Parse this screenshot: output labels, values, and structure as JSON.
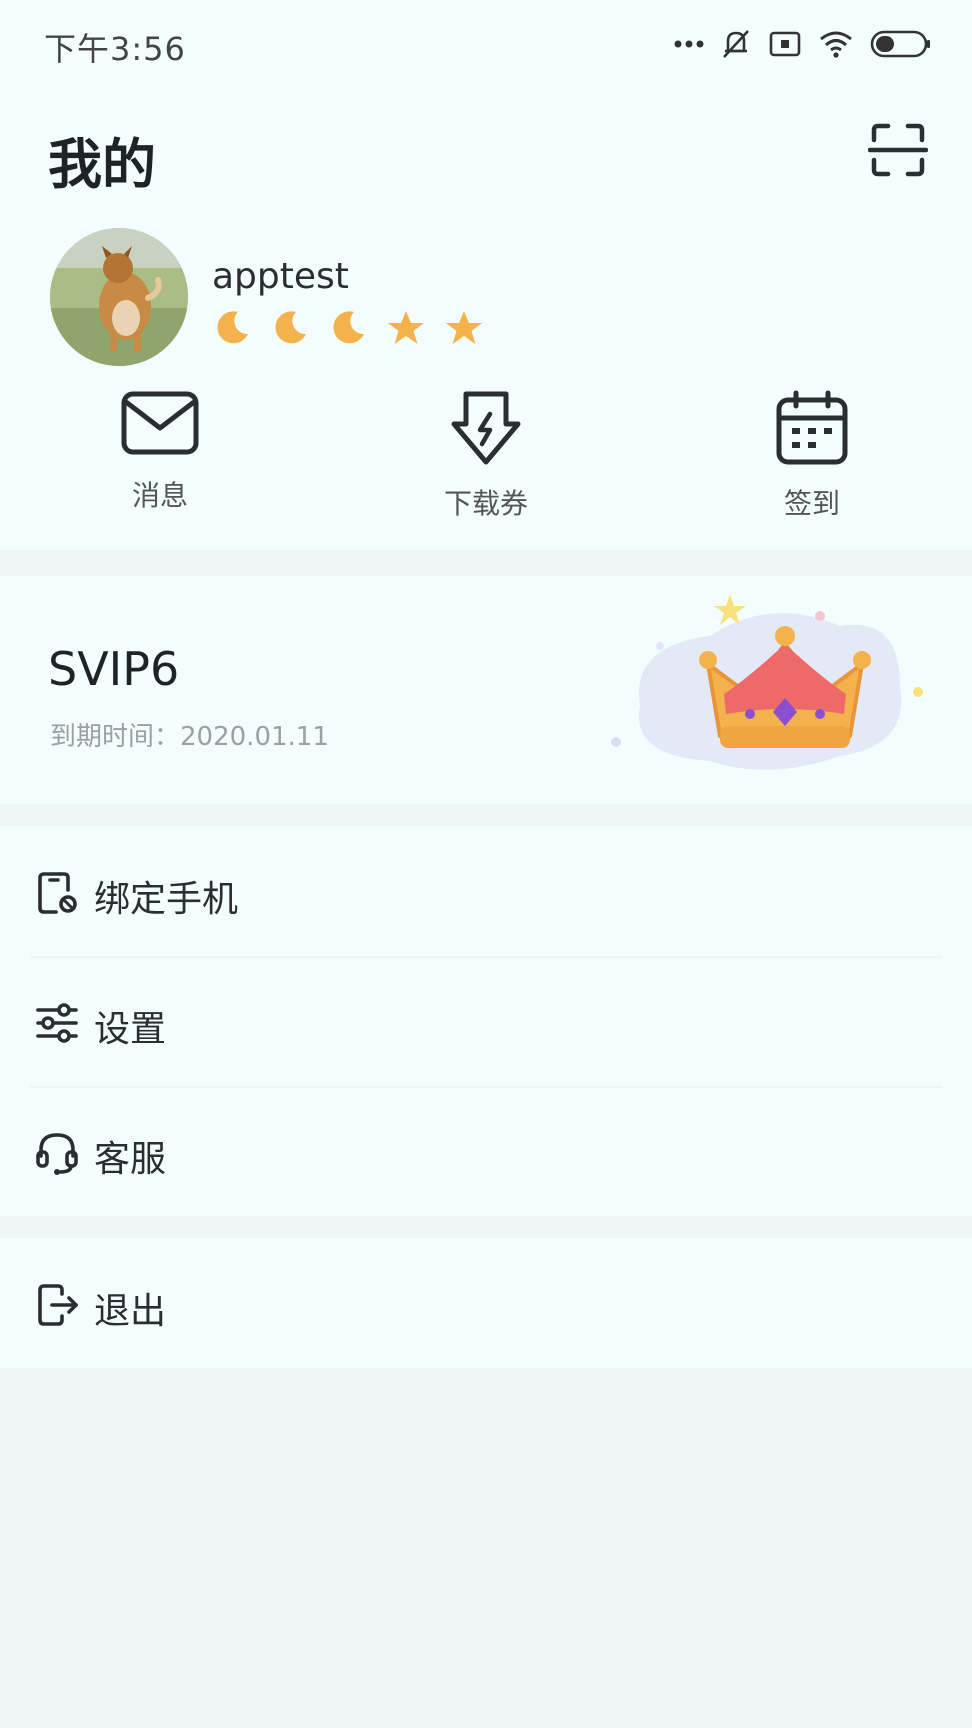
{
  "status_bar": {
    "time": "下午3:56",
    "icons": [
      "more-dots-icon",
      "bell-off-icon",
      "sim-icon",
      "wifi-icon",
      "battery-icon"
    ]
  },
  "header": {
    "title": "我的",
    "scan_icon": "scan-icon"
  },
  "profile": {
    "username": "apptest",
    "rank_icons": [
      "moon-icon",
      "moon-icon",
      "moon-icon",
      "star-icon",
      "star-icon"
    ]
  },
  "quick_actions": [
    {
      "label": "消息",
      "icon": "mail-icon"
    },
    {
      "label": "下载券",
      "icon": "download-ticket-icon"
    },
    {
      "label": "签到",
      "icon": "calendar-icon"
    }
  ],
  "vip": {
    "level": "SVIP6",
    "expire_label": "到期时间：",
    "expire_date": "2020.01.11",
    "badge_icon": "crown-icon"
  },
  "menu": [
    {
      "label": "绑定手机",
      "icon": "phone-bind-icon"
    },
    {
      "label": "设置",
      "icon": "settings-sliders-icon"
    },
    {
      "label": "客服",
      "icon": "headset-icon"
    }
  ],
  "logout": {
    "label": "退出",
    "icon": "logout-icon"
  },
  "colors": {
    "background": "#eef6f6",
    "card": "#f4fdfd",
    "rank_gold": "#f3b24b",
    "text_primary": "#1f2328",
    "text_secondary": "#9aa0a6"
  }
}
